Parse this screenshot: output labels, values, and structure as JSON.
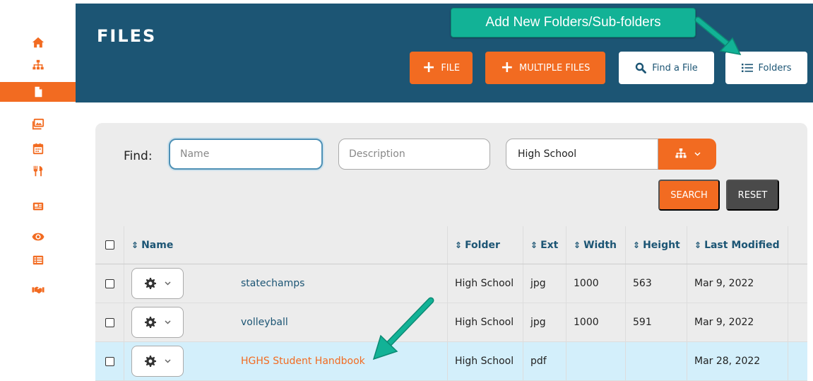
{
  "sidebar": {
    "items": [
      {
        "icon": "home-icon",
        "active": false
      },
      {
        "icon": "sitemap-icon",
        "active": false
      },
      {
        "icon": "file-icon",
        "active": true
      },
      {
        "icon": "images-icon",
        "active": false
      },
      {
        "icon": "calendar-icon",
        "active": false
      },
      {
        "icon": "utensils-icon",
        "active": false
      },
      {
        "icon": "newspaper-icon",
        "active": false
      },
      {
        "icon": "eye-icon",
        "active": false
      },
      {
        "icon": "list-icon",
        "active": false
      },
      {
        "icon": "handshake-icon",
        "active": false
      }
    ]
  },
  "header": {
    "title": "FILES",
    "buttons": {
      "file": "FILE",
      "multiple_files": "MULTIPLE FILES",
      "find_file": "Find a File",
      "folders": "Folders"
    }
  },
  "callout": {
    "text": "Add New Folders/Sub-folders"
  },
  "filter": {
    "find_label": "Find:",
    "name_placeholder": "Name",
    "description_placeholder": "Description",
    "folder_value": "High School",
    "search_label": "SEARCH",
    "reset_label": "RESET"
  },
  "table": {
    "headers": {
      "name": "Name",
      "folder": "Folder",
      "ext": "Ext",
      "width": "Width",
      "height": "Height",
      "last_modified": "Last Modified"
    },
    "rows": [
      {
        "name": "statechamps",
        "folder": "High School",
        "ext": "jpg",
        "width": "1000",
        "height": "563",
        "last_modified": "Mar 9, 2022"
      },
      {
        "name": "volleyball",
        "folder": "High School",
        "ext": "jpg",
        "width": "1000",
        "height": "591",
        "last_modified": "Mar 9, 2022"
      },
      {
        "name": "HGHS Student Handbook",
        "folder": "High School",
        "ext": "pdf",
        "width": "",
        "height": "",
        "last_modified": "Mar 28, 2022"
      }
    ]
  },
  "colors": {
    "brand_orange": "#f26b21",
    "header_blue": "#1c5574",
    "callout_green": "#12b296",
    "highlight_row": "#d3effb",
    "reset_gray": "#4a4a4a"
  }
}
